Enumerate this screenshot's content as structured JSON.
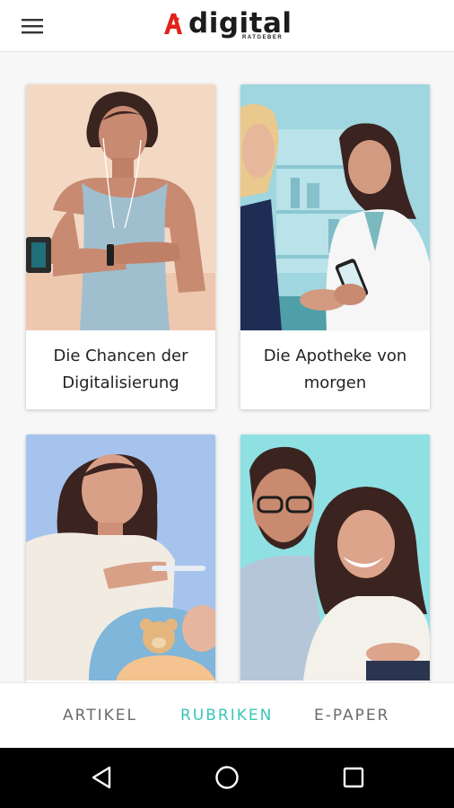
{
  "header": {
    "logo_text": "digital",
    "logo_subtext": "RATGEBER",
    "logo_icon": "apotheke-a-icon",
    "menu_icon": "hamburger-menu-icon"
  },
  "cards": [
    {
      "title": "Die Chancen der Digitalisierung",
      "illustration": "woman-with-smartwatch-and-armband"
    },
    {
      "title": "Die Apotheke von morgen",
      "illustration": "pharmacist-with-smartphone"
    },
    {
      "title": "",
      "illustration": "mother-with-baby-and-thermometer"
    },
    {
      "title": "",
      "illustration": "couple-with-tablet"
    }
  ],
  "bottom_nav": {
    "tabs": [
      {
        "label": "ARTIKEL",
        "active": false
      },
      {
        "label": "RUBRIKEN",
        "active": true
      },
      {
        "label": "E-PAPER",
        "active": false
      }
    ]
  },
  "system_nav": {
    "back": "back-icon",
    "home": "home-icon",
    "recents": "recents-icon"
  },
  "colors": {
    "accent": "#3ac6b7",
    "logo_red": "#e2231a",
    "text": "#222222"
  }
}
